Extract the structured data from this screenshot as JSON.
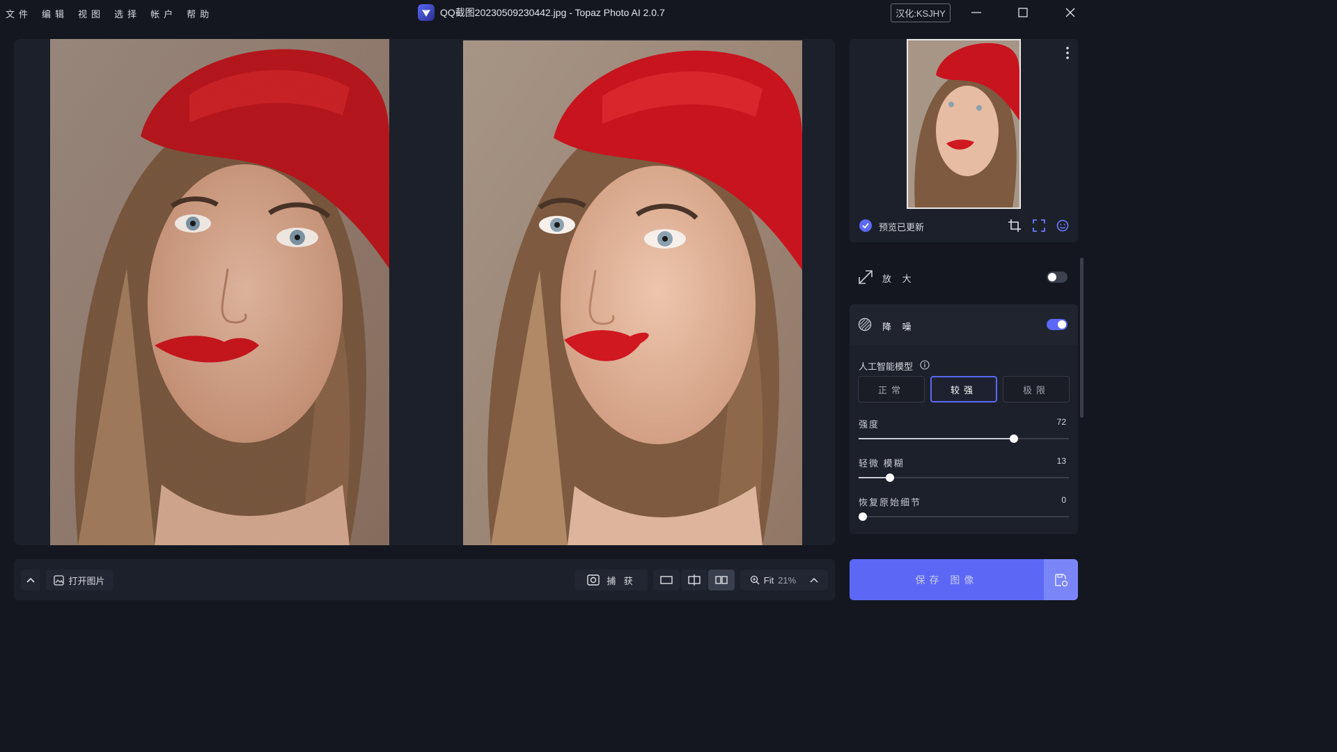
{
  "menu": [
    "文件",
    "编辑",
    "视图",
    "选择",
    "帐户",
    "帮助"
  ],
  "window": {
    "title": "QQ截图20230509230442.jpg - Topaz Photo AI 2.0.7",
    "badge": "汉化:KSJHY"
  },
  "preview": {
    "status": "预览已更新"
  },
  "upscale": {
    "label": "放 大",
    "enabled": false
  },
  "denoise": {
    "label": "降 噪",
    "enabled": true,
    "model_label": "人工智能模型",
    "models": [
      "正常",
      "较强",
      "极限"
    ],
    "selected_model": "较强",
    "sliders": [
      {
        "label": "强度",
        "value": "72",
        "fraction": 0.72
      },
      {
        "label": "轻微 模糊",
        "value": "13",
        "fraction": 0.13
      },
      {
        "label": "恢复原始细节",
        "value": "0",
        "fraction": 0.0
      }
    ]
  },
  "toolbar": {
    "open_label": "打开图片",
    "capture_label": "捕 获",
    "zoom_label": "Fit",
    "zoom_value": "21%"
  },
  "save": {
    "label": "保存 图像"
  },
  "colors": {
    "accent": "#5c68f5",
    "background": "#14171f",
    "panel": "#1c202a",
    "beret": "#c8141e"
  }
}
